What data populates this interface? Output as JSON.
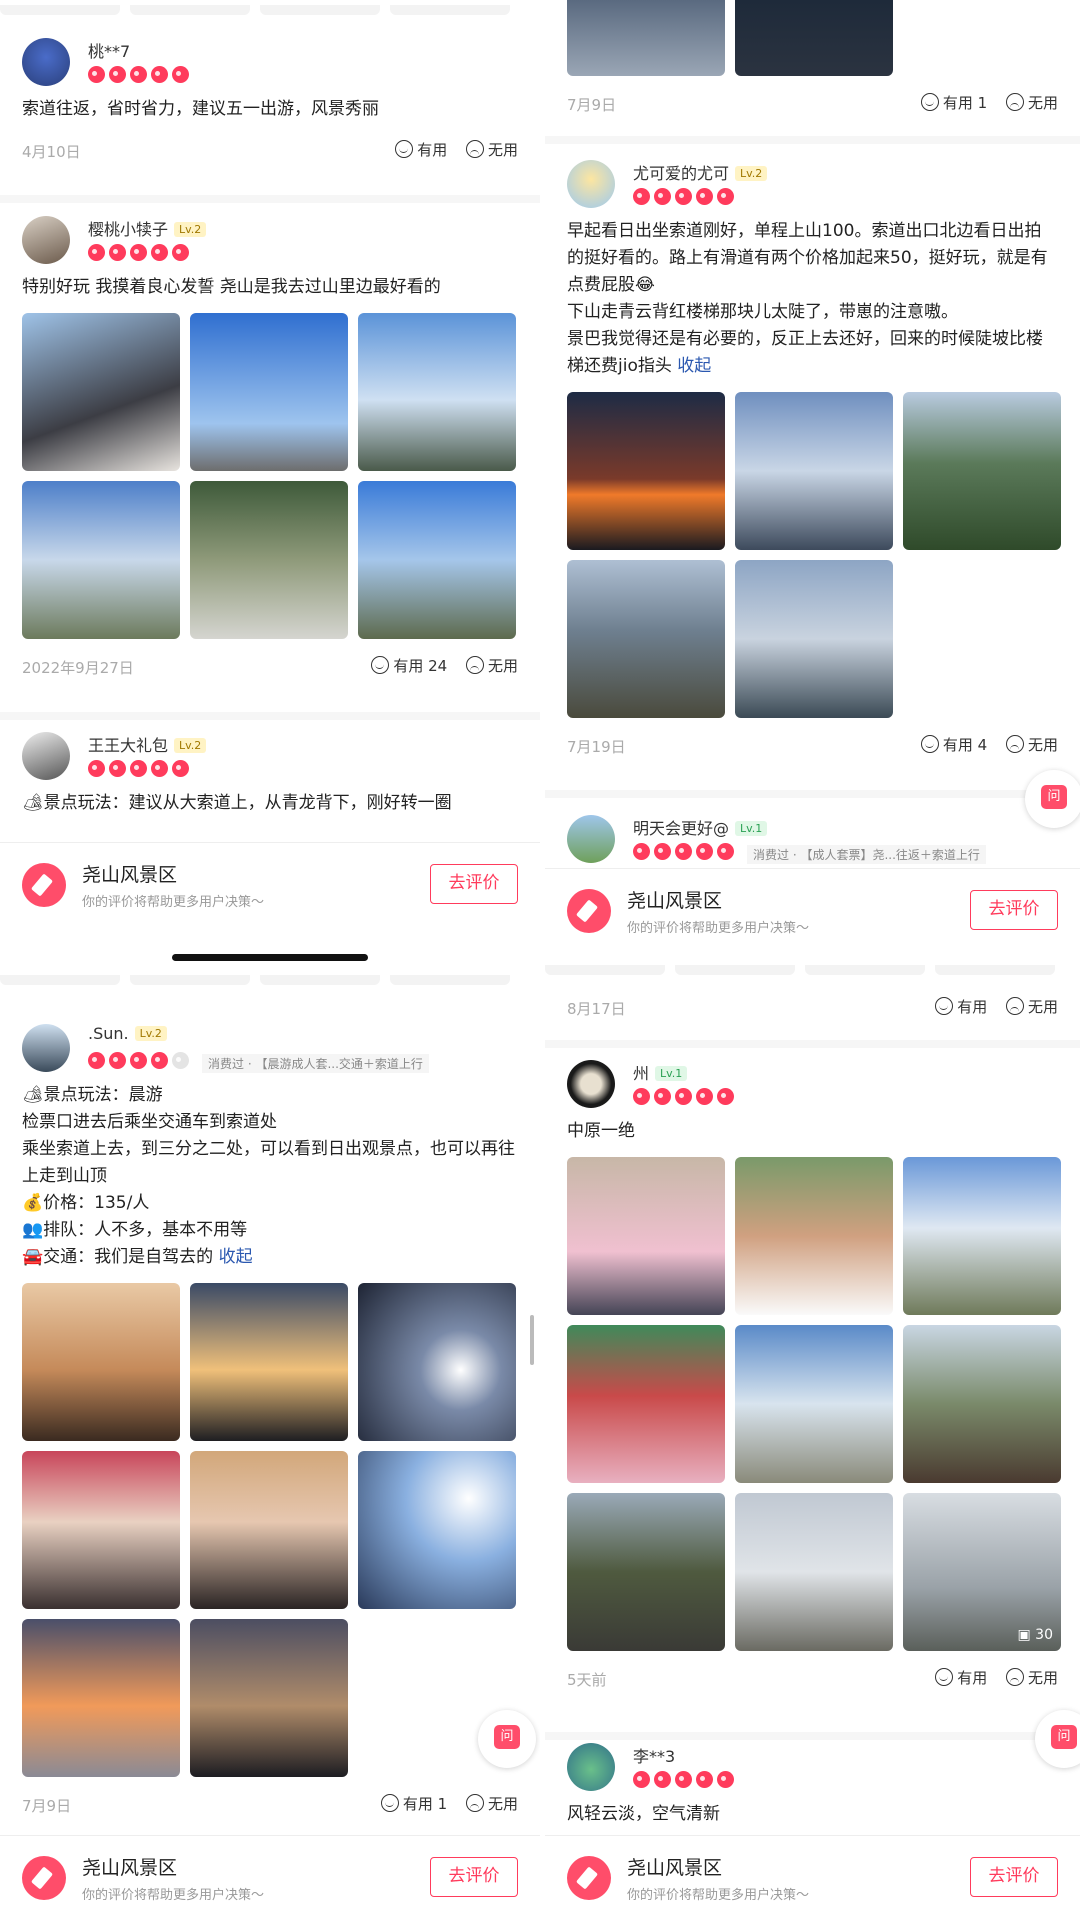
{
  "footer_bar": {
    "name": "尧山风景区",
    "sub": "你的评价将帮助更多用户决策～",
    "button": "去评价"
  },
  "ask_label": "问",
  "helpful": "有用",
  "useless": "无用",
  "panelA": {
    "r1": {
      "user": "桃**7",
      "text": "索道往返，省时省力，建议五一出游，风景秀丽",
      "date": "4月10日",
      "helpful": "有用"
    },
    "r2": {
      "user": "樱桃小犊子",
      "lv": "Lv.2",
      "text": "特别好玩 我摸着良心发誓 尧山是我去过山里边最好看的",
      "date": "2022年9月27日",
      "helpful": "有用 24"
    },
    "r3": {
      "user": "王王大礼包",
      "lv": "Lv.2",
      "text": "🏕景点玩法：建议从大索道上，从青龙背下，刚好转一圈"
    }
  },
  "panelB": {
    "r0": {
      "date": "7月9日",
      "helpful": "有用 1"
    },
    "r1": {
      "user": "尤可爱的尤可",
      "lv": "Lv.2",
      "text": "早起看日出坐索道刚好，单程上山100。索道出口北边看日出拍的挺好看的。路上有滑道有两个价格加起来50，挺好玩，就是有点费屁股😂\n下山走青云背红楼梯那块儿太陡了，带崽的注意嗷。\n景巴我觉得还是有必要的，反正上去还好，回来的时候陡坡比楼梯还费jio指头",
      "more": "收起",
      "date": "7月19日",
      "helpful": "有用 4"
    },
    "r2": {
      "user": "明天会更好@",
      "lv": "Lv.1",
      "consumed": "消费过 · 【成人套票】尧...往返＋索道上行"
    }
  },
  "panelC": {
    "r1": {
      "user": ".Sun.",
      "lv": "Lv.2",
      "consumed": "消费过 · 【晨游成人套...交通＋索道上行",
      "text": "🏕景点玩法：晨游\n检票口进去后乘坐交通车到索道处\n乘坐索道上去，到三分之二处，可以看到日出观景点，也可以再往上走到山顶\n💰价格：135/人\n👥排队：人不多，基本不用等\n🚘交通：我们是自驾去的",
      "more": "收起",
      "date": "7月9日",
      "helpful": "有用 1"
    }
  },
  "panelD": {
    "r0": {
      "date": "8月17日",
      "helpful": "有用"
    },
    "r1": {
      "user": "州",
      "lv": "Lv.1",
      "text": "中原一绝",
      "photo_count": "30",
      "date": "5天前",
      "helpful": "有用"
    },
    "r2": {
      "user": "李**3",
      "text": "风轻云淡，空气清新"
    }
  },
  "colors": {
    "accent": "#ff3b5c",
    "link": "#2b58b0",
    "date": "#aaaaaa"
  }
}
